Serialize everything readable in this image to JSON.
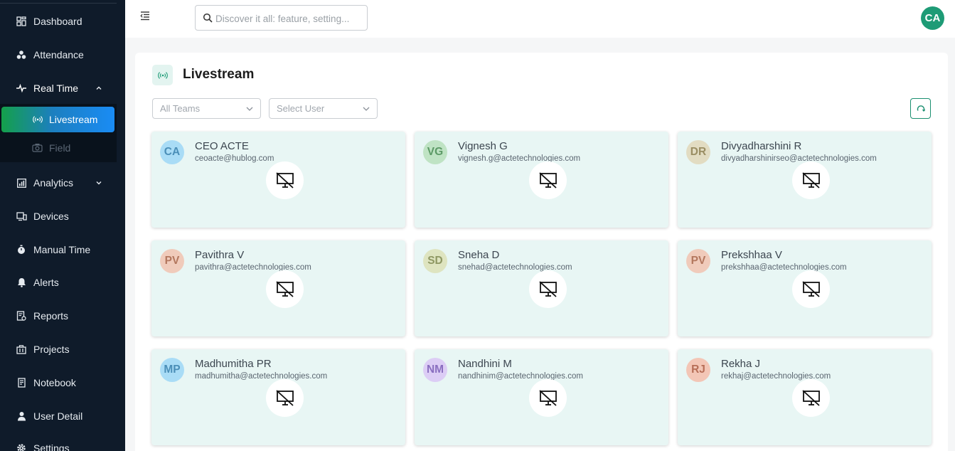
{
  "sidebar": {
    "items": [
      {
        "label": "Dashboard"
      },
      {
        "label": "Attendance"
      },
      {
        "label": "Real Time"
      },
      {
        "label": "Livestream"
      },
      {
        "label": "Field"
      },
      {
        "label": "Analytics"
      },
      {
        "label": "Devices"
      },
      {
        "label": "Manual Time"
      },
      {
        "label": "Alerts"
      },
      {
        "label": "Reports"
      },
      {
        "label": "Projects"
      },
      {
        "label": "Notebook"
      },
      {
        "label": "User Detail"
      },
      {
        "label": "Settings"
      }
    ]
  },
  "header": {
    "search_placeholder": "Discover it all: feature, setting...",
    "user_initials": "CA"
  },
  "page": {
    "title": "Livestream",
    "team_filter": "All Teams",
    "user_filter": "Select User"
  },
  "users": [
    {
      "initials": "CA",
      "name": "CEO ACTE",
      "email": "ceoacte@hublog.com",
      "bg": "#a9dcf6",
      "fg": "#4b8fb8"
    },
    {
      "initials": "VG",
      "name": "Vignesh G",
      "email": "vignesh.g@actetechnologies.com",
      "bg": "#bfe3c4",
      "fg": "#5c9a66"
    },
    {
      "initials": "DR",
      "name": "Divyadharshini R",
      "email": "divyadharshinirseo@actetechnologies.com",
      "bg": "#e2dcc2",
      "fg": "#9a8e63"
    },
    {
      "initials": "PV",
      "name": "Pavithra V",
      "email": "pavithra@actetechnologies.com",
      "bg": "#f0cbbb",
      "fg": "#b3775e"
    },
    {
      "initials": "SD",
      "name": "Sneha D",
      "email": "snehad@actetechnologies.com",
      "bg": "#dee4c0",
      "fg": "#8e9763"
    },
    {
      "initials": "PV",
      "name": "Prekshhaa V",
      "email": "prekshhaa@actetechnologies.com",
      "bg": "#f0cbbb",
      "fg": "#b3775e"
    },
    {
      "initials": "MP",
      "name": "Madhumitha PR",
      "email": "madhumitha@actetechnologies.com",
      "bg": "#a9dcf6",
      "fg": "#4b8fb8"
    },
    {
      "initials": "NM",
      "name": "Nandhini M",
      "email": "nandhinim@actetechnologies.com",
      "bg": "#dccdf5",
      "fg": "#8a6fc0"
    },
    {
      "initials": "RJ",
      "name": "Rekha J",
      "email": "rekhaj@actetechnologies.com",
      "bg": "#f3c6b6",
      "fg": "#b76e57"
    }
  ],
  "colors": {
    "accent": "#1e9b76",
    "sidebar_bg": "#0f1b2a",
    "card_bg": "#e8f6f4"
  },
  "icons": {
    "screen_off": "monitor-off-icon",
    "livestream": "broadcast-icon",
    "refresh": "refresh-icon"
  }
}
